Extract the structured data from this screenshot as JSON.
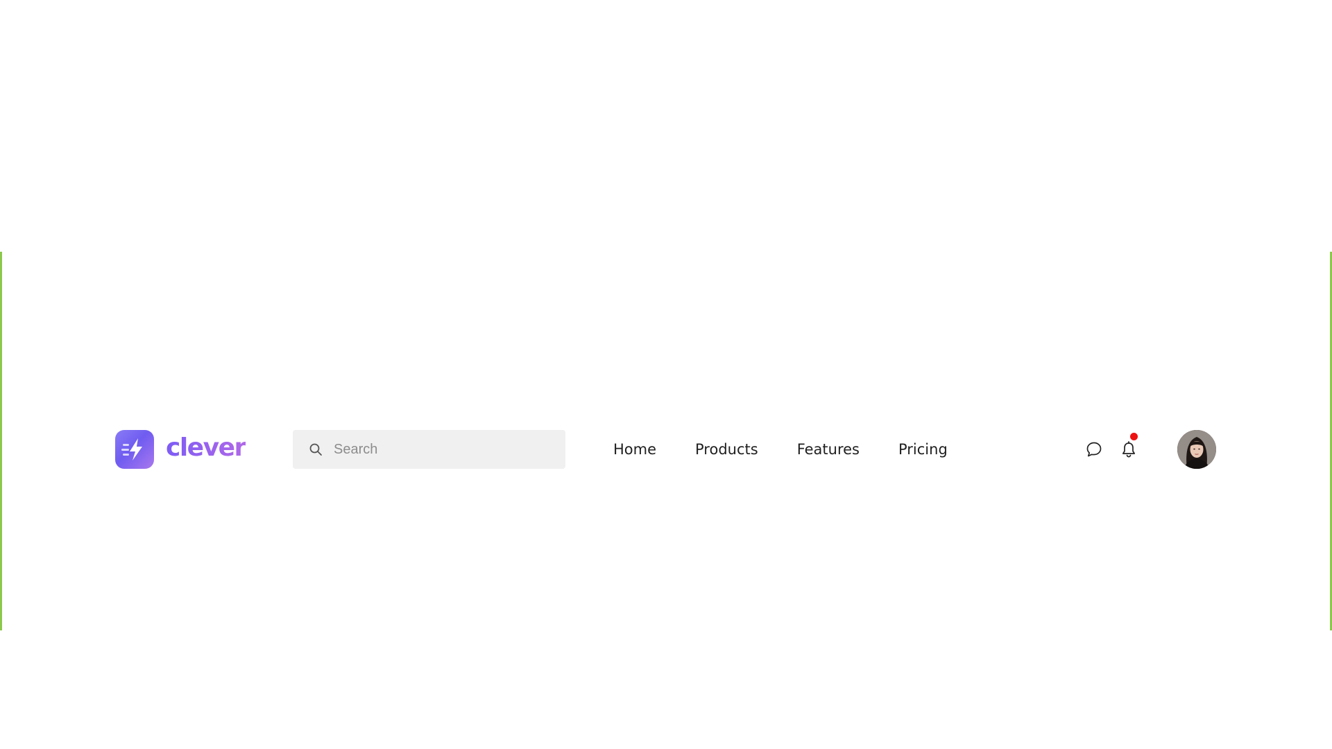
{
  "colors": {
    "frame": "#8cc84b",
    "brand_start": "#7d5cf5",
    "brand_end": "#b068e8",
    "notification_dot": "#ee1111",
    "search_bg": "#f0f0f0"
  },
  "brand": {
    "name": "clever",
    "logo_icon": "lightning-bolt-icon"
  },
  "search": {
    "placeholder": "Search",
    "value": "",
    "icon": "search-icon"
  },
  "nav": {
    "items": [
      {
        "label": "Home"
      },
      {
        "label": "Products"
      },
      {
        "label": "Features"
      },
      {
        "label": "Pricing"
      }
    ]
  },
  "actions": {
    "chat_icon": "chat-bubble-icon",
    "bell_icon": "bell-icon",
    "has_notification": true
  },
  "user": {
    "avatar": "user-avatar-photo"
  }
}
